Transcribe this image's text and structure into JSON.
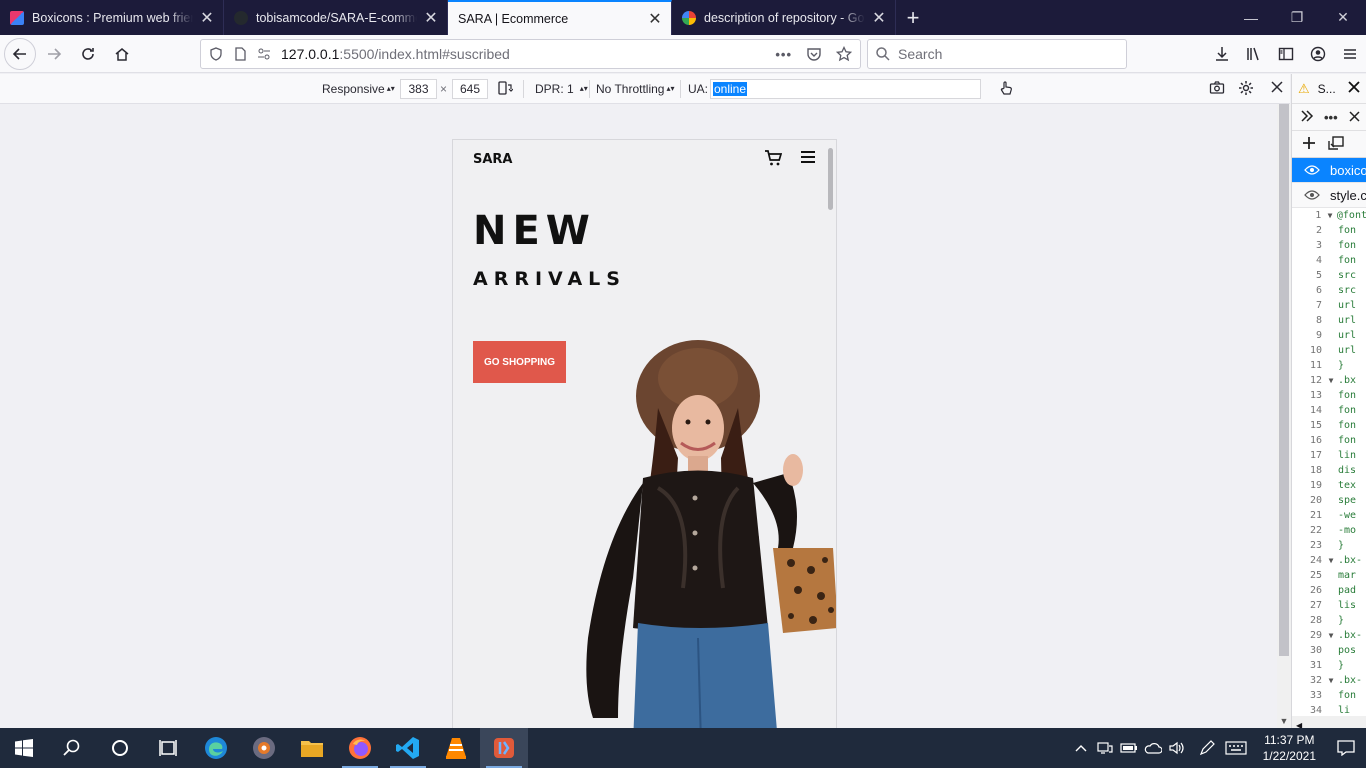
{
  "tabs": [
    {
      "title": "Boxicons : Premium web friendly icons",
      "favicon_color": "#e8386d",
      "active": false
    },
    {
      "title": "tobisamcode/SARA-E-commerce",
      "favicon_color": "#24292e",
      "active": false
    },
    {
      "title": "SARA | Ecommerce",
      "favicon_color": "",
      "active": true
    },
    {
      "title": "description of repository - Google Search",
      "favicon_color": "#4285f4",
      "active": false
    }
  ],
  "url": {
    "host": "127.0.0.1",
    "rest": ":5500/index.html#suscribed"
  },
  "search": {
    "placeholder": "Search"
  },
  "rdm": {
    "device": "Responsive",
    "width": "383",
    "times": "×",
    "height": "645",
    "dpr": "DPR: 1",
    "throttling": "No Throttling",
    "ua_label": "UA:",
    "ua_value": "online"
  },
  "site": {
    "logo": "SARA",
    "headline": "NEW",
    "subheadline": "ARRIVALS",
    "cta": "GO SHOPPING"
  },
  "devtools": {
    "tab_label": "S...",
    "files": [
      {
        "name": "boxicons",
        "active": true
      },
      {
        "name": "style.css",
        "active": false
      }
    ],
    "code_lines": [
      {
        "n": "1",
        "fold": true,
        "text": "@font"
      },
      {
        "n": "2",
        "fold": false,
        "text": "fon"
      },
      {
        "n": "3",
        "fold": false,
        "text": "fon"
      },
      {
        "n": "4",
        "fold": false,
        "text": "fon"
      },
      {
        "n": "5",
        "fold": false,
        "text": "src"
      },
      {
        "n": "6",
        "fold": false,
        "text": "src"
      },
      {
        "n": "7",
        "fold": false,
        "text": "url"
      },
      {
        "n": "8",
        "fold": false,
        "text": "url"
      },
      {
        "n": "9",
        "fold": false,
        "text": "url"
      },
      {
        "n": "10",
        "fold": false,
        "text": "url"
      },
      {
        "n": "11",
        "fold": false,
        "text": "}"
      },
      {
        "n": "12",
        "fold": true,
        "text": ".bx"
      },
      {
        "n": "13",
        "fold": false,
        "text": "fon"
      },
      {
        "n": "14",
        "fold": false,
        "text": "fon"
      },
      {
        "n": "15",
        "fold": false,
        "text": "fon"
      },
      {
        "n": "16",
        "fold": false,
        "text": "fon"
      },
      {
        "n": "17",
        "fold": false,
        "text": "lin"
      },
      {
        "n": "18",
        "fold": false,
        "text": "dis"
      },
      {
        "n": "19",
        "fold": false,
        "text": "tex"
      },
      {
        "n": "20",
        "fold": false,
        "text": "spe"
      },
      {
        "n": "21",
        "fold": false,
        "text": "-we"
      },
      {
        "n": "22",
        "fold": false,
        "text": "-mo"
      },
      {
        "n": "23",
        "fold": false,
        "text": "}"
      },
      {
        "n": "24",
        "fold": true,
        "text": ".bx-"
      },
      {
        "n": "25",
        "fold": false,
        "text": "mar"
      },
      {
        "n": "26",
        "fold": false,
        "text": "pad"
      },
      {
        "n": "27",
        "fold": false,
        "text": "lis"
      },
      {
        "n": "28",
        "fold": false,
        "text": "}"
      },
      {
        "n": "29",
        "fold": true,
        "text": ".bx-"
      },
      {
        "n": "30",
        "fold": false,
        "text": "pos"
      },
      {
        "n": "31",
        "fold": false,
        "text": "}"
      },
      {
        "n": "32",
        "fold": true,
        "text": ".bx-"
      },
      {
        "n": "33",
        "fold": false,
        "text": "fon"
      },
      {
        "n": "34",
        "fold": false,
        "text": "li"
      }
    ]
  },
  "taskbar": {
    "time": "11:37 PM",
    "date": "1/22/2021",
    "apps": [
      "start",
      "search",
      "cortana",
      "task-view",
      "edge",
      "media-player",
      "file-explorer",
      "firefox",
      "vscode",
      "vlc",
      "app"
    ]
  }
}
